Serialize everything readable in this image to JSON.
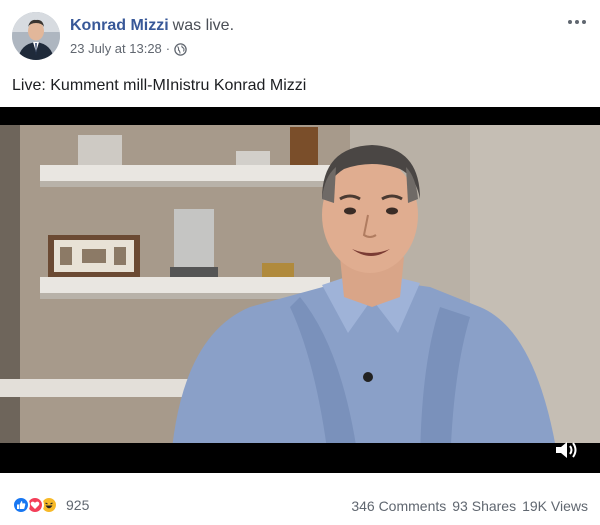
{
  "post": {
    "author": {
      "name": "Konrad Mizzi",
      "action": "was live."
    },
    "meta": {
      "date": "23 July at 13:28",
      "separator": "·",
      "privacy_icon": "globe-icon"
    },
    "more_icon": "more-options-icon",
    "caption": "Live: Kumment mill-MInistru Konrad Mizzi",
    "video": {
      "thumbnail_subject": "man in light blue shirt speaking in front of shelves",
      "volume_icon": "volume-icon"
    },
    "footer": {
      "reaction_icons": [
        "like-icon",
        "love-icon",
        "haha-icon"
      ],
      "reaction_count": "925",
      "comments": "346 Comments",
      "shares": "93 Shares",
      "views": "19K Views"
    }
  },
  "colors": {
    "author_link": "#385898",
    "like": "#1877f2",
    "love": "#f33e58",
    "haha": "#f7b928",
    "muted_text": "#606770"
  }
}
